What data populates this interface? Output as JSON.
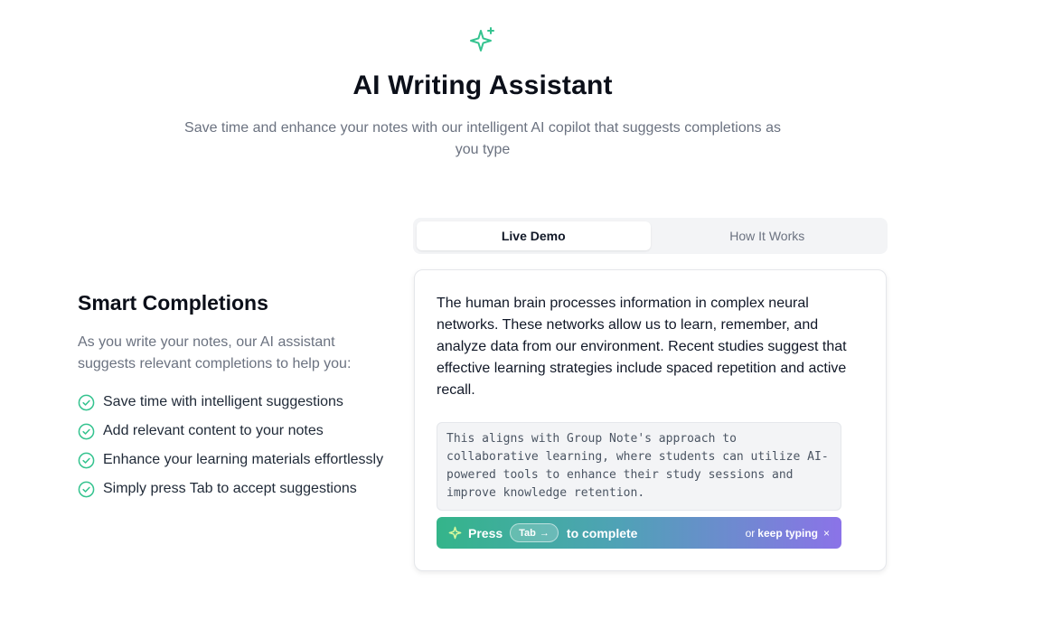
{
  "hero": {
    "icon": "sparkles-icon",
    "title": "AI Writing Assistant",
    "subtitle": "Save time and enhance your notes with our intelligent AI copilot that suggests completions as you type"
  },
  "features": {
    "heading": "Smart Completions",
    "description": "As you write your notes, our AI assistant suggests relevant completions to help you:",
    "items": [
      "Save time with intelligent suggestions",
      "Add relevant content to your notes",
      "Enhance your learning materials effortlessly",
      "Simply press Tab to accept suggestions"
    ],
    "check_icon": "check-circle-icon"
  },
  "tabs": [
    {
      "label": "Live Demo",
      "active": true
    },
    {
      "label": "How It Works",
      "active": false
    }
  ],
  "demo": {
    "body_text": "The human brain processes information in complex neural networks. These networks allow us to learn, remember, and analyze data from our environment. Recent studies suggest that effective learning strategies include spaced repetition and active recall.",
    "suggestion_text": "This aligns with Group Note's approach to collaborative learning, where students can utilize AI-powered tools to enhance their study sessions and improve knowledge retention.",
    "bar": {
      "press_label": "Press",
      "key_label": "Tab",
      "key_arrow": "→",
      "complete_label": "to complete",
      "or_label": "or",
      "keep_typing_label": "keep typing",
      "close_symbol": "×"
    }
  },
  "colors": {
    "accent_green": "#34c38f",
    "gradient_start": "#34b58a",
    "gradient_end": "#8b73e8"
  }
}
